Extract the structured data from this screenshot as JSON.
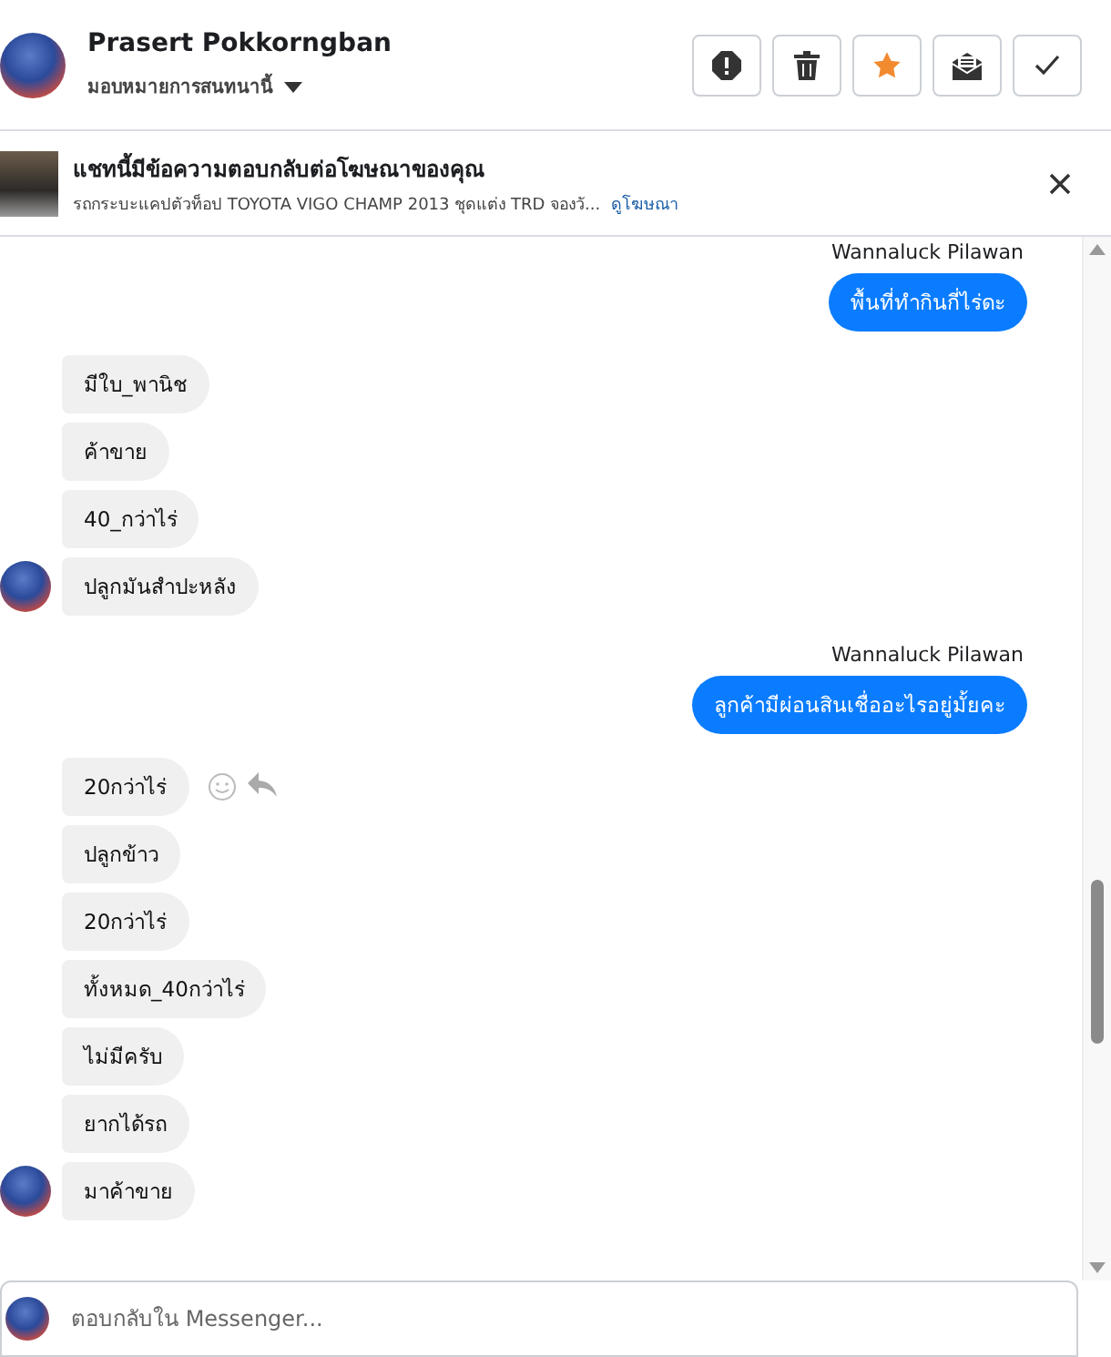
{
  "header": {
    "name": "Prasert Pokkorngban",
    "assign_label": "มอบหมายการสนทนานี้",
    "buttons": [
      {
        "kind": "report",
        "on": false
      },
      {
        "kind": "delete",
        "on": false
      },
      {
        "kind": "star",
        "on": true
      },
      {
        "kind": "unread",
        "on": false
      },
      {
        "kind": "done",
        "on": false
      }
    ]
  },
  "ad_banner": {
    "title": "แชทนี้มีข้อความตอบกลับต่อโฆษณาของคุณ",
    "description": "รถกระบะแคปตัวท็อป TOYOTA VIGO CHAMP 2013 ชุดแต่ง TRD จองวั...",
    "link": "ดูโฆษณา"
  },
  "messages": [
    {
      "kind": "out",
      "sender": "Wannaluck Pilawan",
      "items": [
        {
          "text": "พื้นที่ทำกินกี่ไร่ดะ",
          "actions_shown": false
        }
      ]
    },
    {
      "kind": "in",
      "items": [
        {
          "text": "มีใบ_พานิช",
          "actions_shown": false
        },
        {
          "text": "ค้าขาย",
          "actions_shown": false
        },
        {
          "text": "40_กว่าไร่",
          "actions_shown": false
        },
        {
          "text": "ปลูกมันสำปะหลัง",
          "actions_shown": false
        }
      ]
    },
    {
      "kind": "out",
      "sender": "Wannaluck Pilawan",
      "items": [
        {
          "text": "ลูกค้ามีผ่อนสินเชื่ออะไรอยู่มั้ยคะ",
          "actions_shown": false
        }
      ]
    },
    {
      "kind": "in",
      "items": [
        {
          "text": "20กว่าไร่",
          "actions_shown": true
        },
        {
          "text": "ปลูกข้าว",
          "actions_shown": false
        },
        {
          "text": "20กว่าไร่",
          "actions_shown": false
        },
        {
          "text": "ทั้งหมด_40กว่าไร่",
          "actions_shown": false
        },
        {
          "text": "ไม่มีครับ",
          "actions_shown": false
        },
        {
          "text": "ยากได้รถ",
          "actions_shown": false
        },
        {
          "text": "มาค้าขาย",
          "actions_shown": false
        }
      ]
    }
  ],
  "composer": {
    "placeholder": "ตอบกลับใน Messenger..."
  }
}
